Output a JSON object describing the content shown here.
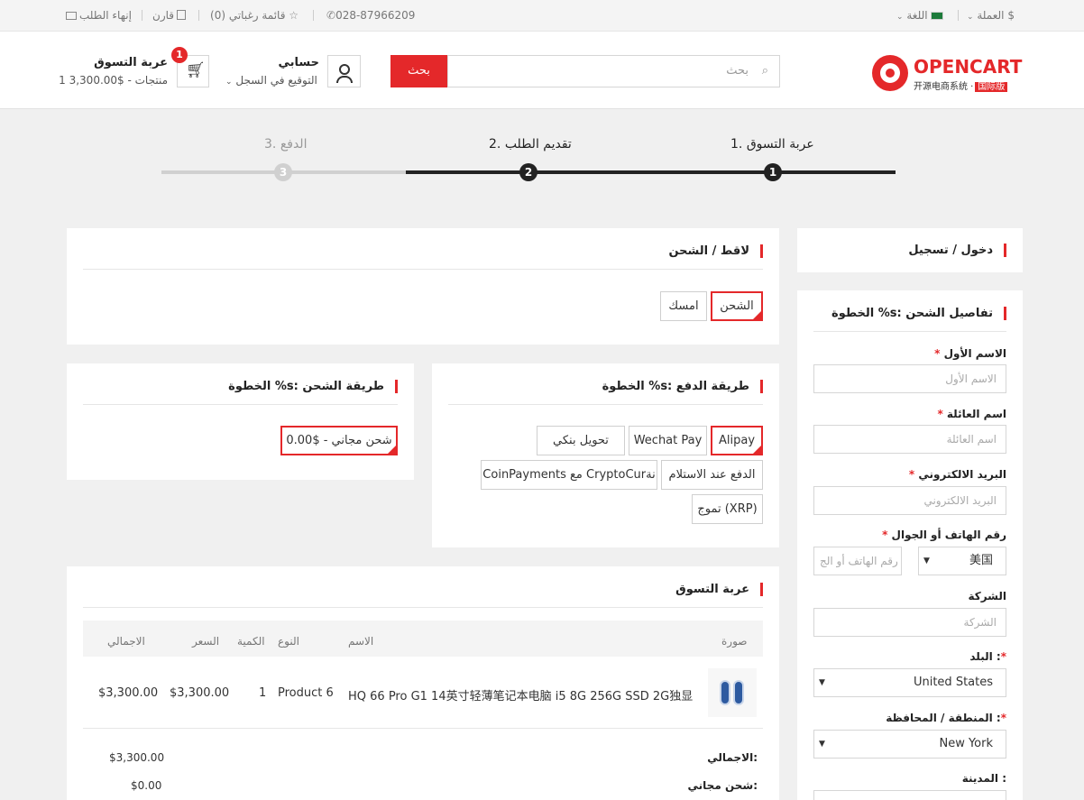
{
  "topbar": {
    "currency": "العملة",
    "currency_symbol": "$",
    "language": "اللغة",
    "phone": "028-87966209",
    "wishlist": "قائمة رغباتي (0)",
    "compare": "قارن",
    "checkout": "إنهاء الطلب"
  },
  "header": {
    "logo_text": "OPENCART",
    "logo_sub": "开源电商系统 ·",
    "logo_badge": "国际版",
    "search_placeholder": "بحث",
    "search_button": "بحث",
    "account_title": "حسابي",
    "account_sub": "التوقيع في السجل",
    "cart_title": "عربة التسوق",
    "cart_sub": "1 منتجات - $3,300.00",
    "cart_count": "1"
  },
  "steps": [
    {
      "num": "1",
      "label": "1. عربة التسوق",
      "state": "done"
    },
    {
      "num": "2",
      "label": "2. تقديم الطلب",
      "state": "active"
    },
    {
      "num": "3",
      "label": "3. الدفع",
      "state": "todo"
    }
  ],
  "login_card": {
    "title": "دخول / تسجيل"
  },
  "shipping_details": {
    "title": "الخطوة %s: تفاصيل الشحن",
    "first_name_label": "الاسم الأول",
    "first_name_placeholder": "الاسم الأول",
    "last_name_label": "اسم العائلة",
    "last_name_placeholder": "اسم العائلة",
    "email_label": "البريد الالكتروني",
    "email_placeholder": "البريد الالكتروني",
    "phone_label": "رقم الهاتف أو الجوال",
    "phone_placeholder": "رقم الهاتف أو الج",
    "phone_country": "美国",
    "company_label": "الشركة",
    "company_placeholder": "الشركة",
    "country_label": "البلد :",
    "country_value": "United States",
    "zone_label": "المنطقة / المحافظة :",
    "zone_value": "New York",
    "city_label": "المدينة :",
    "required_mark": "*"
  },
  "pickup_card": {
    "title": "لاقط / الشحن",
    "options": [
      "الشحن",
      "امسك"
    ],
    "selected": "الشحن"
  },
  "payment_card": {
    "title": "الخطوة %s: طريقة الدفع",
    "options": [
      "Alipay",
      "Wechat Pay",
      "تحويل بنكي",
      "الدفع عند الاستلام",
      "CoinPayments مع CryptoCurنة",
      "تموج (XRP)"
    ],
    "selected": "Alipay"
  },
  "shipping_method_card": {
    "title": "الخطوة %s: طريقة الشحن",
    "option": "شحن مجاني - $0.00"
  },
  "cart_card": {
    "title": "عربة التسوق",
    "columns": {
      "image": "صورة",
      "name": "الاسم",
      "model": "النوع",
      "qty": "الكمية",
      "price": "السعر",
      "total": "الاجمالي"
    },
    "rows": [
      {
        "name": "HQ 66 Pro G1 14英寸轻薄笔记本电脑 i5 8G 256G SSD 2G独显",
        "model": "Product 6",
        "qty": "1",
        "price": "$3,300.00",
        "total": "$3,300.00"
      }
    ],
    "totals": [
      {
        "label": "الاجمالي:",
        "value": "$3,300.00"
      },
      {
        "label": "شحن مجاني:",
        "value": "$0.00"
      }
    ]
  },
  "colors": {
    "accent": "#e4282a",
    "dark": "#222222",
    "muted": "#cccccc"
  }
}
